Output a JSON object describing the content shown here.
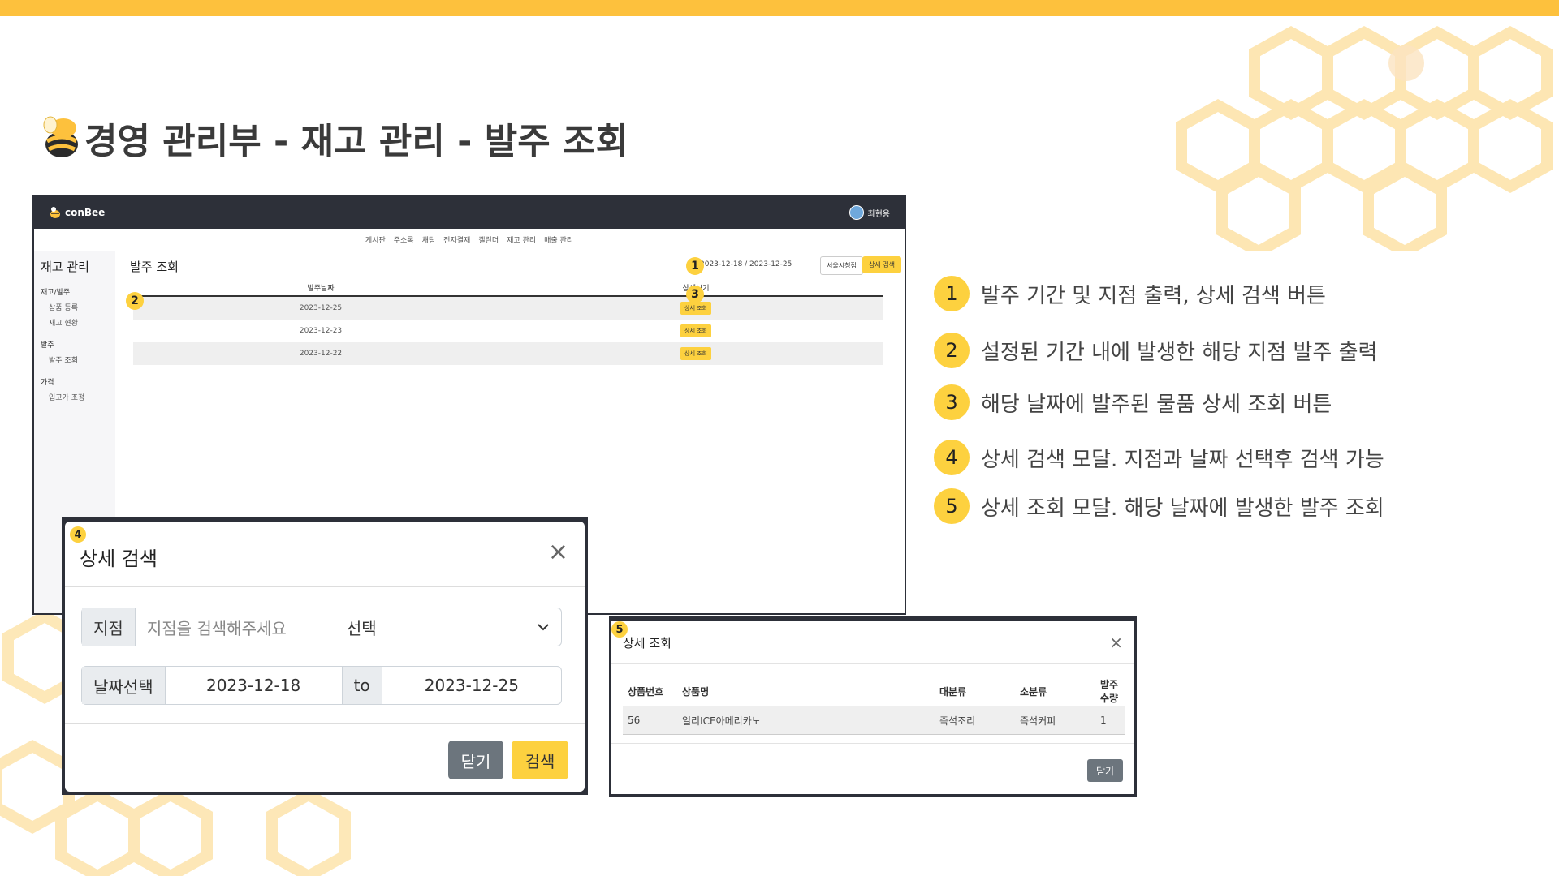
{
  "slide": {
    "title": "경영 관리부 - 재고 관리 - 발주 조회",
    "accent_color": "#fdc13d"
  },
  "app": {
    "logo": "conBee",
    "user_name": "최현용",
    "nav": [
      "게시판",
      "주소록",
      "채팅",
      "전자결재",
      "캘린더",
      "재고 관리",
      "매출 관리"
    ],
    "sidebar": {
      "title": "재고 관리",
      "groups": [
        {
          "label": "재고/발주",
          "items": [
            "상품 등록",
            "재고 현황"
          ]
        },
        {
          "label": "발주",
          "items": [
            "발주 조회"
          ]
        },
        {
          "label": "가격",
          "items": [
            "입고가 조정"
          ]
        }
      ]
    },
    "main": {
      "title": "발주 조회",
      "period": "2023-12-18 / 2023-12-25",
      "branch_button": "서울시청점",
      "detail_search_button": "상세 검색",
      "columns": [
        "발주날짜",
        "상세보기"
      ],
      "rows": [
        {
          "date": "2023-12-25",
          "action": "상세 조회"
        },
        {
          "date": "2023-12-23",
          "action": "상세 조회"
        },
        {
          "date": "2023-12-22",
          "action": "상세 조회"
        }
      ]
    }
  },
  "search_modal": {
    "title": "상세 검색",
    "branch_label": "지점",
    "branch_placeholder": "지점을 검색해주세요",
    "select_value": "선택",
    "date_label": "날짜선택",
    "start_date": "2023-12-18",
    "to_label": "to",
    "end_date": "2023-12-25",
    "close_button": "닫기",
    "search_button": "검색"
  },
  "view_modal": {
    "title": "상세 조회",
    "columns": [
      "상품번호",
      "상품명",
      "대분류",
      "소분류",
      "발주수량"
    ],
    "rows": [
      [
        "56",
        "일리ICE아메리카노",
        "즉석조리",
        "즉석커피",
        "1"
      ]
    ],
    "close_button": "닫기"
  },
  "badges": [
    "1",
    "2",
    "3",
    "4",
    "5"
  ],
  "legend": [
    {
      "num": "1",
      "text": "발주 기간 및 지점 출력, 상세 검색 버튼"
    },
    {
      "num": "2",
      "text": "설정된 기간 내에 발생한 해당 지점 발주 출력"
    },
    {
      "num": "3",
      "text": "해당 날짜에 발주된 물품 상세 조회 버튼"
    },
    {
      "num": "4",
      "text": "상세 검색 모달. 지점과 날짜 선택후 검색 가능"
    },
    {
      "num": "5",
      "text": "상세 조회 모달. 해당 날짜에 발생한 발주 조회"
    }
  ]
}
